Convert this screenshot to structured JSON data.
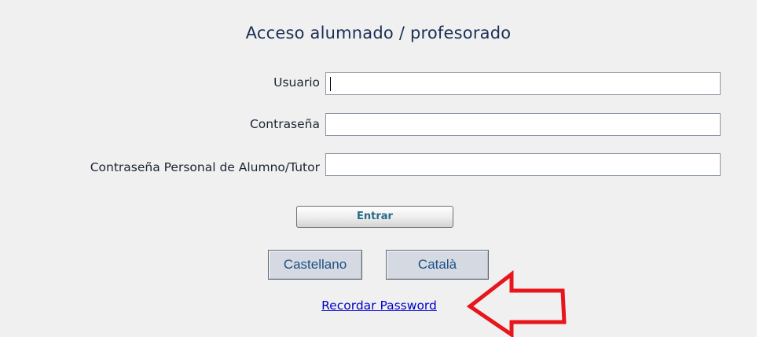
{
  "form": {
    "title": "Acceso alumnado / profesorado",
    "fields": [
      {
        "label": "Usuario",
        "value": ""
      },
      {
        "label": "Contraseña",
        "value": ""
      },
      {
        "label": "Contraseña Personal de Alumno/Tutor",
        "value": ""
      }
    ],
    "submit_label": "Entrar"
  },
  "languages": [
    {
      "label": "Castellano"
    },
    {
      "label": "Català"
    }
  ],
  "recover_link": "Recordar Password",
  "annotation": {
    "arrow_icon": "left-arrow-icon",
    "arrow_color": "#e8151b"
  }
}
